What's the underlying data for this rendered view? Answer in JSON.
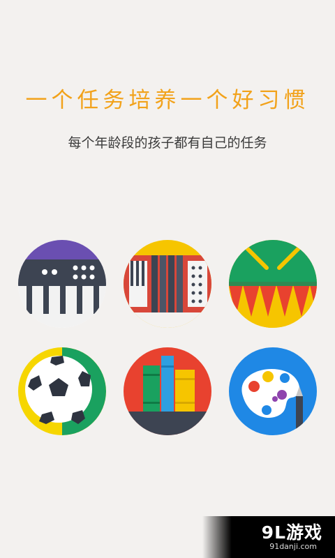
{
  "header": {
    "title": "一个任务培养一个好习惯",
    "subtitle": "每个年龄段的孩子都有自己的任务"
  },
  "icons": [
    {
      "name": "synthesizer-icon"
    },
    {
      "name": "accordion-icon"
    },
    {
      "name": "drum-icon"
    },
    {
      "name": "soccer-ball-icon"
    },
    {
      "name": "books-icon"
    },
    {
      "name": "paint-palette-icon"
    }
  ],
  "watermark": {
    "logo": "9L游戏",
    "url": "91danji.com"
  },
  "colors": {
    "background": "#f3f1ef",
    "title": "#f2a21a",
    "subtitle": "#3a3a3a"
  }
}
